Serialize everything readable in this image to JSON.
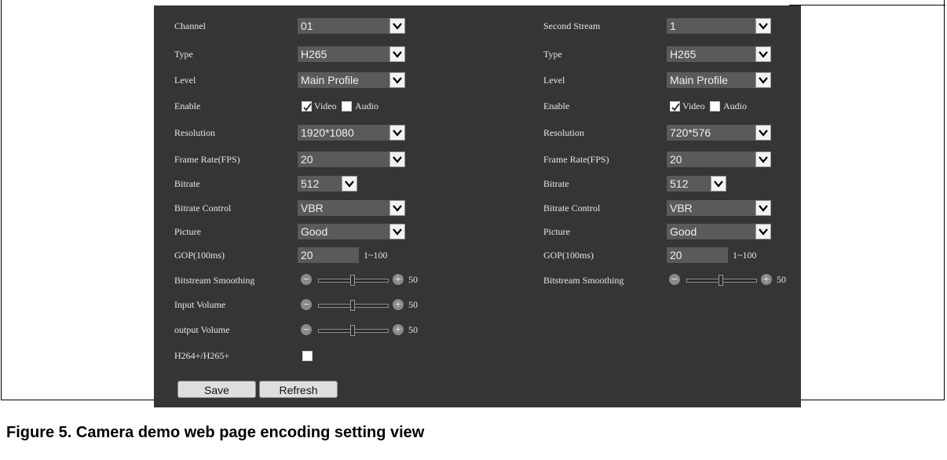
{
  "left": {
    "channel": {
      "label": "Channel",
      "value": "01"
    },
    "type": {
      "label": "Type",
      "value": "H265"
    },
    "level": {
      "label": "Level",
      "value": "Main Profile"
    },
    "enable": {
      "label": "Enable",
      "video": "Video",
      "audio": "Audio",
      "video_checked": true,
      "audio_checked": false
    },
    "resolution": {
      "label": "Resolution",
      "value": "1920*1080"
    },
    "frame_rate": {
      "label": "Frame Rate(FPS)",
      "value": "20"
    },
    "bitrate": {
      "label": "Bitrate",
      "value": "512"
    },
    "bitrate_control": {
      "label": "Bitrate Control",
      "value": "VBR"
    },
    "picture": {
      "label": "Picture",
      "value": "Good"
    },
    "gop": {
      "label": "GOP(100ms)",
      "value": "20",
      "range": "1~100"
    },
    "bitstream_smoothing": {
      "label": "Bitstream Smoothing",
      "value": "50",
      "level": 0.5
    },
    "input_volume": {
      "label": "Input Volume",
      "value": "50",
      "level": 0.5
    },
    "output_volume": {
      "label": "output Volume",
      "value": "50",
      "level": 0.5
    },
    "h264plus": {
      "label": "H264+/H265+",
      "checked": false
    }
  },
  "right": {
    "second_stream": {
      "label": "Second Stream",
      "value": "1"
    },
    "type": {
      "label": "Type",
      "value": "H265"
    },
    "level": {
      "label": "Level",
      "value": "Main Profile"
    },
    "enable": {
      "label": "Enable",
      "video": "Video",
      "audio": "Audio",
      "video_checked": true,
      "audio_checked": false
    },
    "resolution": {
      "label": "Resolution",
      "value": "720*576"
    },
    "frame_rate": {
      "label": "Frame Rate(FPS)",
      "value": "20"
    },
    "bitrate": {
      "label": "Bitrate",
      "value": "512"
    },
    "bitrate_control": {
      "label": "Bitrate Control",
      "value": "VBR"
    },
    "picture": {
      "label": "Picture",
      "value": "Good"
    },
    "gop": {
      "label": "GOP(100ms)",
      "value": "20",
      "range": "1~100"
    },
    "bitstream_smoothing": {
      "label": "Bitstream Smoothing",
      "value": "50",
      "level": 0.5
    }
  },
  "buttons": {
    "save": "Save",
    "refresh": "Refresh"
  },
  "caption": "Figure 5.  Camera demo web page encoding setting view",
  "colors": {
    "panel_bg": "#353535",
    "field_bg": "#5a5a5a",
    "label_text": "#e6e6e6"
  }
}
